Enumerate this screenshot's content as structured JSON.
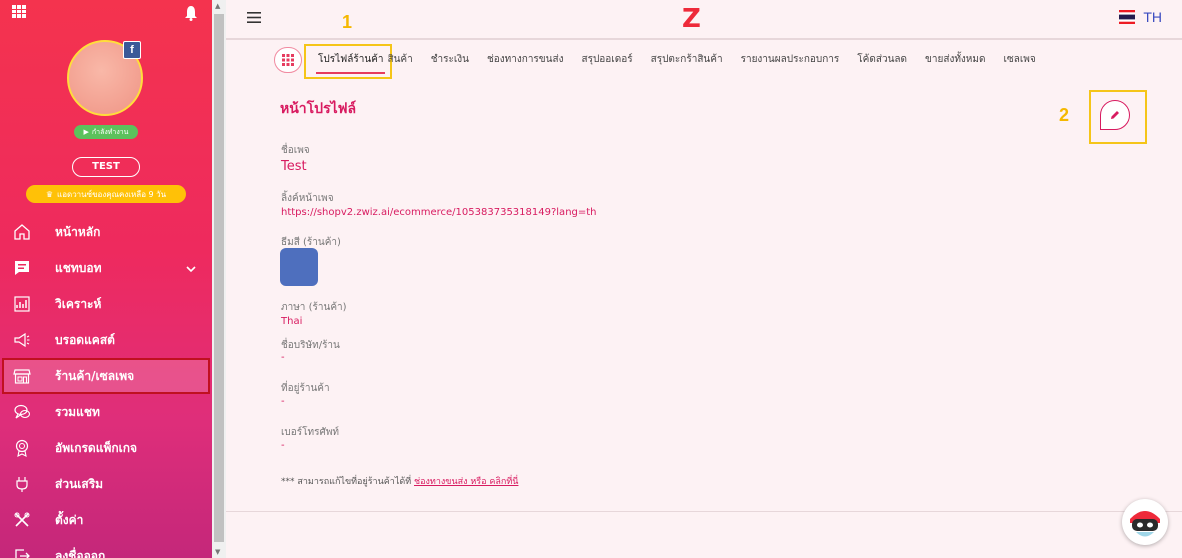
{
  "sidebar": {
    "profile": {
      "status": "กำลังทำงาน",
      "name": "TEST",
      "trial": "แอดวานซ์ของคุณคงเหลือ 9 วัน"
    },
    "items": [
      {
        "label": "หน้าหลัก",
        "icon": "home-icon"
      },
      {
        "label": "แชทบอท",
        "icon": "chat-icon"
      },
      {
        "label": "วิเคราะห์",
        "icon": "analytics-icon"
      },
      {
        "label": "บรอดแคสต์",
        "icon": "megaphone-icon"
      },
      {
        "label": "ร้านค้า/เซลเพจ",
        "icon": "store-icon"
      },
      {
        "label": "รวมแชท",
        "icon": "chats-icon"
      },
      {
        "label": "อัพเกรดแพ็กเกจ",
        "icon": "badge-icon"
      },
      {
        "label": "ส่วนเสริม",
        "icon": "plugin-icon"
      },
      {
        "label": "ตั้งค่า",
        "icon": "tools-icon"
      },
      {
        "label": "ลงชื่อออก",
        "icon": "logout-icon"
      }
    ]
  },
  "header": {
    "logo": "Z",
    "lang": "TH"
  },
  "annotations": {
    "one": "1",
    "two": "2"
  },
  "tabs": [
    "โปรไฟล์ร้านค้า",
    "สินค้า",
    "ชำระเงิน",
    "ช่องทางการขนส่ง",
    "สรุปออเดอร์",
    "สรุปตะกร้าสินค้า",
    "รายงานผลประกอบการ",
    "โค้ดส่วนลด",
    "ขายส่งทั้งหมด",
    "เซลเพจ"
  ],
  "profile": {
    "title": "หน้าโปรไฟล์",
    "page_name_label": "ชื่อเพจ",
    "page_name": "Test",
    "page_link_label": "ลิ้งค์หน้าเพจ",
    "page_link": "https://shopv2.zwiz.ai/ecommerce/105383735318149?lang=th",
    "theme_label": "ธีมสี (ร้านค้า)",
    "theme_color": "#4e6fbe",
    "language_label": "ภาษา (ร้านค้า)",
    "language": "Thai",
    "company_label": "ชื่อบริษัท/ร้าน",
    "company": "-",
    "address_label": "ที่อยู่ร้านค้า",
    "address": "-",
    "phone_label": "เบอร์โทรศัพท์",
    "phone": "-",
    "note_prefix": "*** สามารถแก้ไขที่อยู่ร้านค้าได้ที่ ",
    "note_link": "ช่องทางขนส่ง หรือ คลิกที่นี่"
  }
}
